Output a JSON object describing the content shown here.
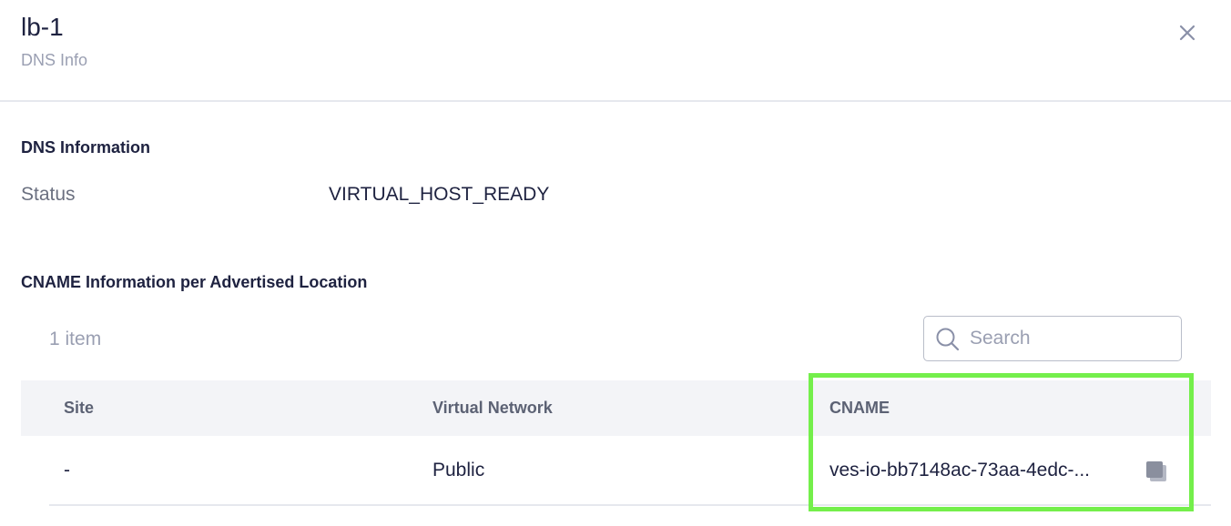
{
  "header": {
    "title": "lb-1",
    "subtitle": "DNS Info",
    "close_icon": "close-icon"
  },
  "dns_info": {
    "section_title": "DNS Information",
    "status_label": "Status",
    "status_value": "VIRTUAL_HOST_READY"
  },
  "cname_info": {
    "section_title": "CNAME Information per Advertised Location",
    "item_count": "1 item",
    "search": {
      "placeholder": "Search",
      "value": "",
      "icon": "search-icon"
    },
    "columns": [
      "Site",
      "Virtual Network",
      "CNAME"
    ],
    "rows": [
      {
        "site": "-",
        "virtual_network": "Public",
        "cname": "ves-io-bb7148ac-73aa-4edc-...",
        "copy_icon": "copy-icon"
      }
    ]
  },
  "colors": {
    "text": "#1e2240",
    "muted": "#9a9fb2",
    "table_header_bg": "#f3f4f7",
    "highlight": "#74ef4b"
  }
}
